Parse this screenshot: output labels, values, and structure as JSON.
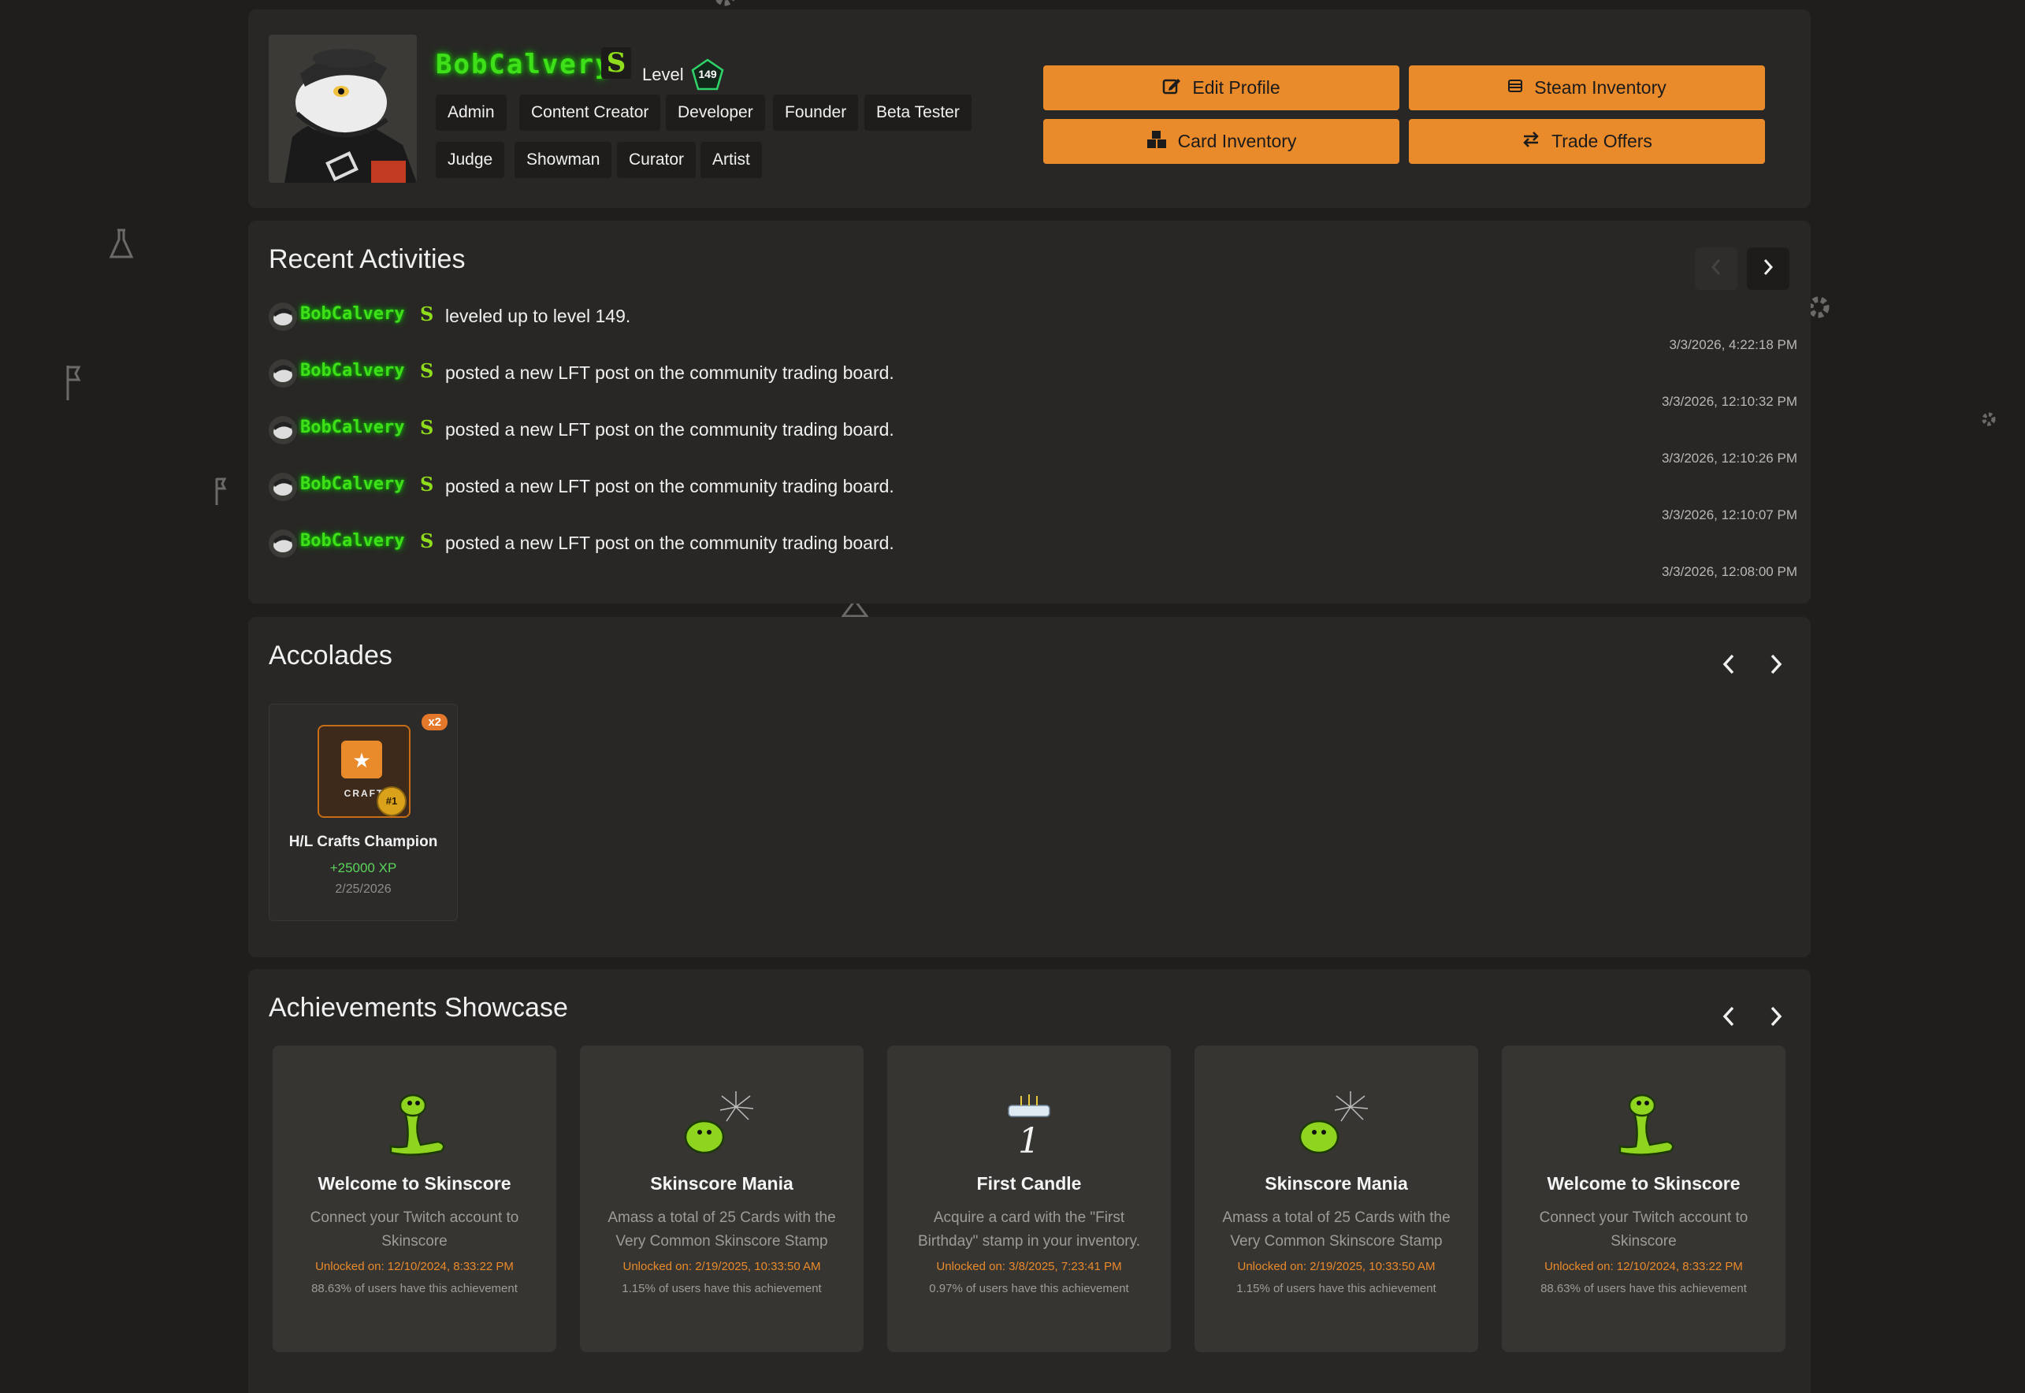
{
  "profile": {
    "username": "BobCalvery",
    "level_label": "Level",
    "level": "149",
    "tags": [
      "Admin",
      "Content Creator",
      "Developer",
      "Founder",
      "Beta Tester",
      "Judge",
      "Showman",
      "Curator",
      "Artist"
    ],
    "buttons": {
      "edit_profile": "Edit Profile",
      "steam_inventory": "Steam Inventory",
      "card_inventory": "Card Inventory",
      "trade_offers": "Trade Offers"
    }
  },
  "activities": {
    "title": "Recent Activities",
    "items": [
      {
        "user": "BobCalvery",
        "text": "leveled up to level 149.",
        "time": "3/3/2026, 4:22:18 PM"
      },
      {
        "user": "BobCalvery",
        "text": "posted a new LFT post on the community trading board.",
        "time": "3/3/2026, 12:10:32 PM"
      },
      {
        "user": "BobCalvery",
        "text": "posted a new LFT post on the community trading board.",
        "time": "3/3/2026, 12:10:26 PM"
      },
      {
        "user": "BobCalvery",
        "text": "posted a new LFT post on the community trading board.",
        "time": "3/3/2026, 12:10:07 PM"
      },
      {
        "user": "BobCalvery",
        "text": "posted a new LFT post on the community trading board.",
        "time": "3/3/2026, 12:08:00 PM"
      }
    ]
  },
  "accolades": {
    "title": "Accolades",
    "items": [
      {
        "name": "H/L Crafts Champion",
        "xp": "+25000 XP",
        "date": "2/25/2026",
        "count": "x2",
        "icon_text": "CRAFT",
        "rank": "#1"
      }
    ]
  },
  "achievements": {
    "title": "Achievements Showcase",
    "items": [
      {
        "title": "Welcome to Skinscore",
        "desc": "Connect your Twitch account to Skinscore",
        "unlocked": "Unlocked on: 12/10/2024, 8:33:22 PM",
        "pct": "88.63% of users have this achievement",
        "icon": "snake-icon"
      },
      {
        "title": "Skinscore Mania",
        "desc": "Amass a total of 25 Cards with the Very Common Skinscore Stamp",
        "unlocked": "Unlocked on: 2/19/2025, 10:33:50 AM",
        "pct": "1.15% of users have this achievement",
        "icon": "snake-firework-icon"
      },
      {
        "title": "First Candle",
        "desc": "Acquire a card with the \"First Birthday\" stamp in your inventory.",
        "unlocked": "Unlocked on: 3/8/2025, 7:23:41 PM",
        "pct": "0.97% of users have this achievement",
        "icon": "birthday-cake-icon"
      },
      {
        "title": "Skinscore Mania",
        "desc": "Amass a total of 25 Cards with the Very Common Skinscore Stamp",
        "unlocked": "Unlocked on: 2/19/2025, 10:33:50 AM",
        "pct": "1.15% of users have this achievement",
        "icon": "snake-firework-icon"
      },
      {
        "title": "Welcome to Skinscore",
        "desc": "Connect your Twitch account to Skinscore",
        "unlocked": "Unlocked on: 12/10/2024, 8:33:22 PM",
        "pct": "88.63% of users have this achievement",
        "icon": "snake-icon"
      }
    ]
  },
  "colors": {
    "background": "#1f1e1c",
    "panel": "#282725",
    "accent": "#e98a2b",
    "username_glow": "#3fe01a",
    "xp_green": "#5bd45b"
  }
}
